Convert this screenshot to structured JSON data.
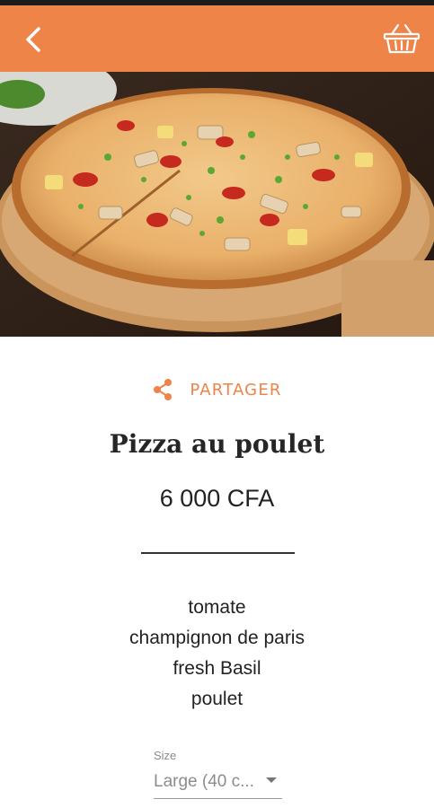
{
  "app_bar": {
    "accent_color": "#ee8448",
    "back_icon": "chevron-left-icon",
    "cart_icon": "shopping-basket-icon"
  },
  "hero": {
    "image": "pizza-photo"
  },
  "share": {
    "icon": "share-icon",
    "label": "PARTAGER"
  },
  "product": {
    "name": "Pizza au poulet",
    "price": "6 000 CFA",
    "ingredients": [
      "tomate",
      "champignon de paris",
      "fresh Basil",
      "poulet"
    ]
  },
  "size": {
    "label": "Size",
    "selected": "Large (40 c..."
  }
}
